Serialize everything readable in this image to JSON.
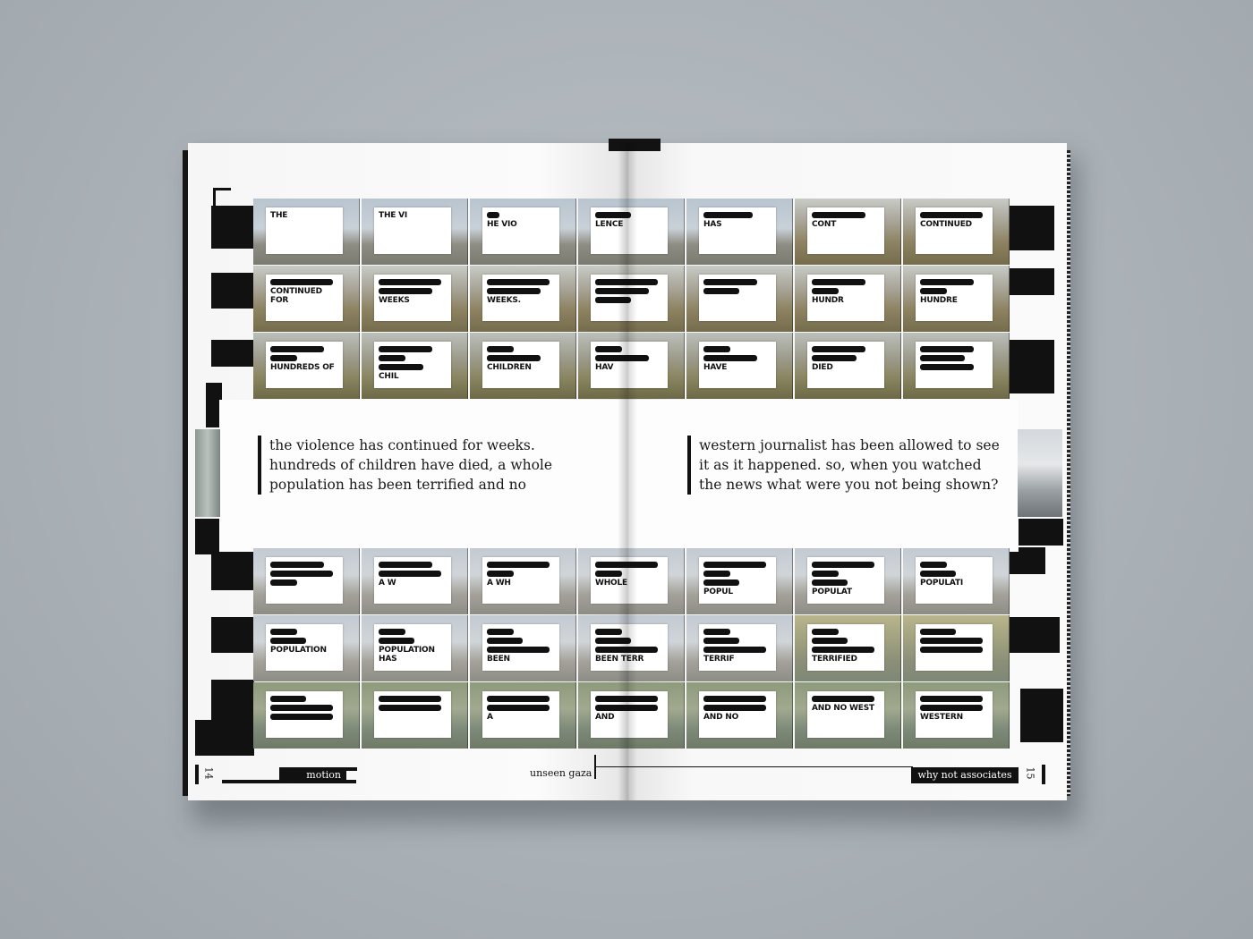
{
  "strips": [
    {
      "scene": "sky",
      "frames": [
        {
          "text": "THE",
          "redact": []
        },
        {
          "text": "THE VI",
          "redact": []
        },
        {
          "text": "HE VIO",
          "redact": [
            14
          ]
        },
        {
          "text": "LENCE",
          "redact": [
            40
          ]
        },
        {
          "text": "HAS",
          "redact": [
            55
          ]
        },
        {
          "text": "CONT",
          "redact": [
            60
          ]
        },
        {
          "text": "CONTINUED",
          "redact": [
            70
          ]
        }
      ]
    },
    {
      "scene": "field",
      "frames": [
        {
          "text": "CONTINUED FOR",
          "redact": [
            70
          ]
        },
        {
          "text": "WEEKS",
          "redact": [
            70,
            60
          ]
        },
        {
          "text": "WEEKS.",
          "redact": [
            70,
            60
          ]
        },
        {
          "text": "",
          "redact": [
            70,
            60,
            40
          ]
        },
        {
          "text": "",
          "redact": [
            60,
            40
          ]
        },
        {
          "text": "HUNDR",
          "redact": [
            60,
            30
          ]
        },
        {
          "text": "HUNDRE",
          "redact": [
            60,
            30
          ]
        }
      ]
    },
    {
      "scene": "field2",
      "frames": [
        {
          "text": "HUNDREDS OF",
          "redact": [
            60,
            30
          ]
        },
        {
          "text": "CHIL",
          "redact": [
            60,
            30,
            50
          ]
        },
        {
          "text": "CHILDREN",
          "redact": [
            30,
            60
          ]
        },
        {
          "text": "HAV",
          "redact": [
            30,
            60
          ]
        },
        {
          "text": "HAVE",
          "redact": [
            30,
            60
          ]
        },
        {
          "text": "DIED",
          "redact": [
            60,
            50
          ]
        },
        {
          "text": "",
          "redact": [
            60,
            50,
            60
          ]
        }
      ]
    },
    {
      "scene": "beach",
      "frames": [
        {
          "text": "",
          "redact": [
            60,
            70,
            30
          ]
        },
        {
          "text": "A W",
          "redact": [
            60,
            70
          ]
        },
        {
          "text": "A WH",
          "redact": [
            70,
            30
          ]
        },
        {
          "text": "WHOLE",
          "redact": [
            70,
            30
          ]
        },
        {
          "text": "POPUL",
          "redact": [
            70,
            30,
            40
          ]
        },
        {
          "text": "POPULAT",
          "redact": [
            70,
            30,
            40
          ]
        },
        {
          "text": "POPULATI",
          "redact": [
            30,
            40
          ]
        }
      ]
    },
    {
      "scene": "beach",
      "frames": [
        {
          "text": "POPULATION",
          "redact": [
            30,
            40
          ]
        },
        {
          "text": "POPULATION HAS",
          "redact": [
            30,
            40
          ]
        },
        {
          "text": "BEEN",
          "redact": [
            30,
            40,
            70
          ]
        },
        {
          "text": "BEEN TERR",
          "redact": [
            30,
            40,
            70
          ]
        },
        {
          "text": "TERRIF",
          "redact": [
            30,
            40,
            70
          ]
        },
        {
          "text": "TERRIFIED",
          "redact": [
            30,
            40,
            70
          ]
        },
        {
          "text": "",
          "redact": [
            40,
            70,
            70
          ]
        }
      ]
    },
    {
      "scene": "murky",
      "frames": [
        {
          "text": "",
          "redact": [
            40,
            70,
            70
          ]
        },
        {
          "text": "",
          "redact": [
            70,
            70
          ]
        },
        {
          "text": "A",
          "redact": [
            70,
            70
          ]
        },
        {
          "text": "AND",
          "redact": [
            70,
            70
          ]
        },
        {
          "text": "AND NO",
          "redact": [
            70,
            70
          ]
        },
        {
          "text": "AND NO WEST",
          "redact": [
            70
          ]
        },
        {
          "text": "WESTERN",
          "redact": [
            70,
            70
          ]
        }
      ]
    }
  ],
  "quote_left": "the violence has continued for weeks. hundreds of children have died, a whole population has been terrified and no",
  "quote_right": "western journalist has been allowed to see it as it happened. so, when you watched the news what were you not being shown?",
  "footer": {
    "left_page_number": "14",
    "right_page_number": "15",
    "left_section": "motion",
    "center_title": "unseen gaza",
    "right_section": "why not associates"
  },
  "colors": {
    "ink": "#111111",
    "paper": "#fafafa",
    "background": "#a9b0b6"
  }
}
